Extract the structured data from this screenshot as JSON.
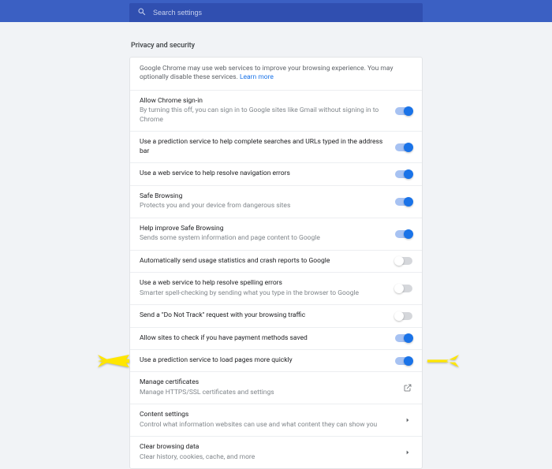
{
  "search": {
    "placeholder": "Search settings"
  },
  "section_title": "Privacy and security",
  "intro": {
    "text": "Google Chrome may use web services to improve your browsing experience. You may optionally disable these services. ",
    "link": "Learn more"
  },
  "rows": [
    {
      "title": "Allow Chrome sign-in",
      "sub": "By turning this off, you can sign in to Google sites like Gmail without signing in to Chrome",
      "control": "toggle",
      "state": true
    },
    {
      "title": "Use a prediction service to help complete searches and URLs typed in the address bar",
      "sub": null,
      "control": "toggle",
      "state": true
    },
    {
      "title": "Use a web service to help resolve navigation errors",
      "sub": null,
      "control": "toggle",
      "state": true
    },
    {
      "title": "Safe Browsing",
      "sub": "Protects you and your device from dangerous sites",
      "control": "toggle",
      "state": true
    },
    {
      "title": "Help improve Safe Browsing",
      "sub": "Sends some system information and page content to Google",
      "control": "toggle",
      "state": true
    },
    {
      "title": "Automatically send usage statistics and crash reports to Google",
      "sub": null,
      "control": "toggle",
      "state": false
    },
    {
      "title": "Use a web service to help resolve spelling errors",
      "sub": "Smarter spell-checking by sending what you type in the browser to Google",
      "control": "toggle",
      "state": false
    },
    {
      "title": "Send a \"Do Not Track\" request with your browsing traffic",
      "sub": null,
      "control": "toggle",
      "state": false
    },
    {
      "title": "Allow sites to check if you have payment methods saved",
      "sub": null,
      "control": "toggle",
      "state": true
    },
    {
      "title": "Use a prediction service to load pages more quickly",
      "sub": null,
      "control": "toggle",
      "state": true
    },
    {
      "title": "Manage certificates",
      "sub": "Manage HTTPS/SSL certificates and settings",
      "control": "external",
      "state": null
    },
    {
      "title": "Content settings",
      "sub": "Control what information websites can use and what content they can show you",
      "control": "chevron",
      "state": null
    },
    {
      "title": "Clear browsing data",
      "sub": "Clear history, cookies, cache, and more",
      "control": "chevron",
      "state": null
    }
  ]
}
